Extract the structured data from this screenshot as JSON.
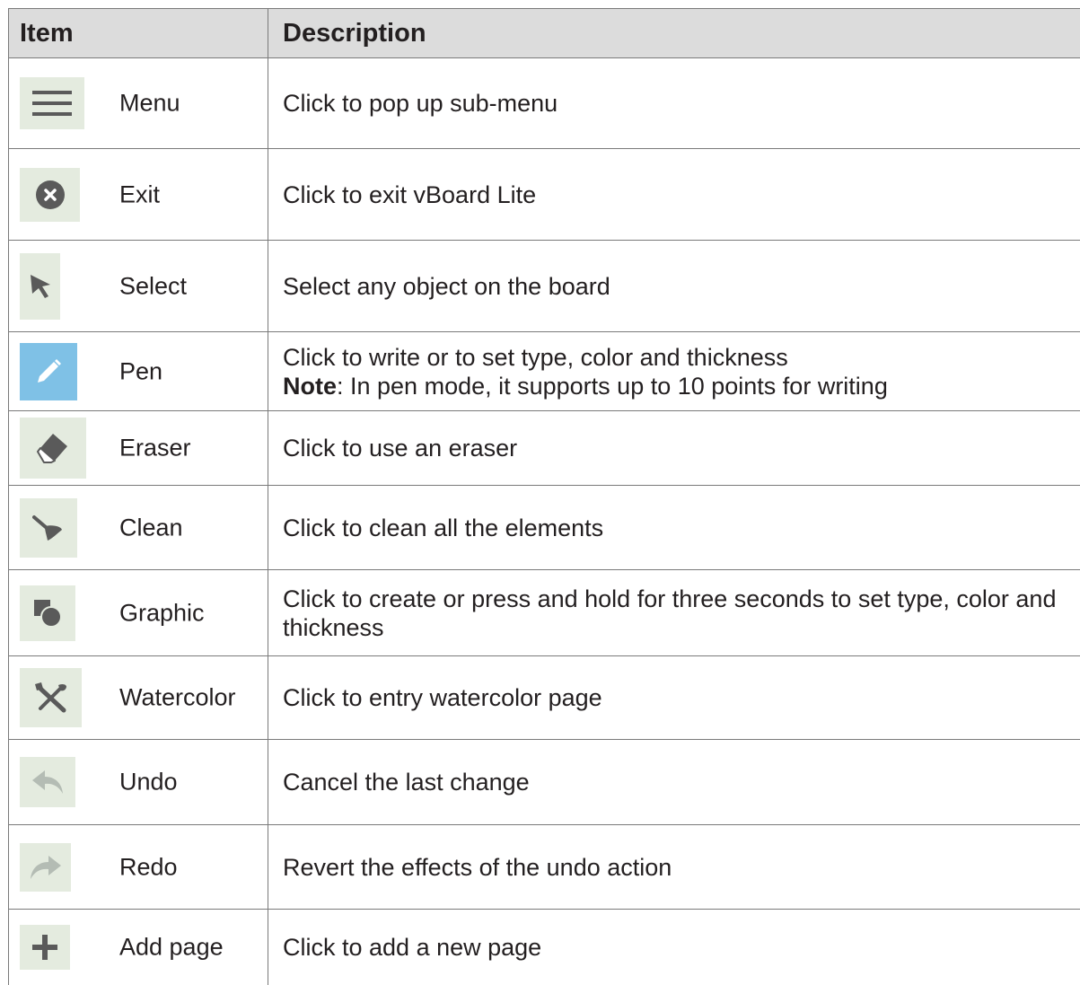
{
  "header": {
    "item": "Item",
    "description": "Description"
  },
  "rows": [
    {
      "icon": "menu-icon",
      "item": "Menu",
      "description": "Click to pop up sub-menu"
    },
    {
      "icon": "exit-icon",
      "item": "Exit",
      "description": "Click to exit vBoard Lite"
    },
    {
      "icon": "select-arrow-icon",
      "item": "Select",
      "description": "Select any object on the board"
    },
    {
      "icon": "pen-icon",
      "item": "Pen",
      "description": "Click to write or to set type, color and thickness",
      "note_label": "Note",
      "note_text": ": In pen mode, it supports up to 10 points for writing"
    },
    {
      "icon": "eraser-icon",
      "item": "Eraser",
      "description": "Click to use an eraser"
    },
    {
      "icon": "clean-brush-icon",
      "item": "Clean",
      "description": "Click to clean all the elements"
    },
    {
      "icon": "graphic-shapes-icon",
      "item": "Graphic",
      "description": "Click to create or press and hold for three seconds to set type, color and thickness"
    },
    {
      "icon": "watercolor-icon",
      "item": "Watercolor",
      "description": "Click to entry watercolor page"
    },
    {
      "icon": "undo-icon",
      "item": "Undo",
      "description": "Cancel the last change"
    },
    {
      "icon": "redo-icon",
      "item": "Redo",
      "description": "Revert the effects of the undo action"
    },
    {
      "icon": "add-page-icon",
      "item": "Add page",
      "description": "Click to add a new page"
    }
  ],
  "colors": {
    "header_bg": "#dcdcdc",
    "icon_bg": "#e4ebdf",
    "pen_icon_bg": "#7fc1e6",
    "icon_fg": "#5a5a5a",
    "muted_icon_fg": "#b4bcb4"
  }
}
